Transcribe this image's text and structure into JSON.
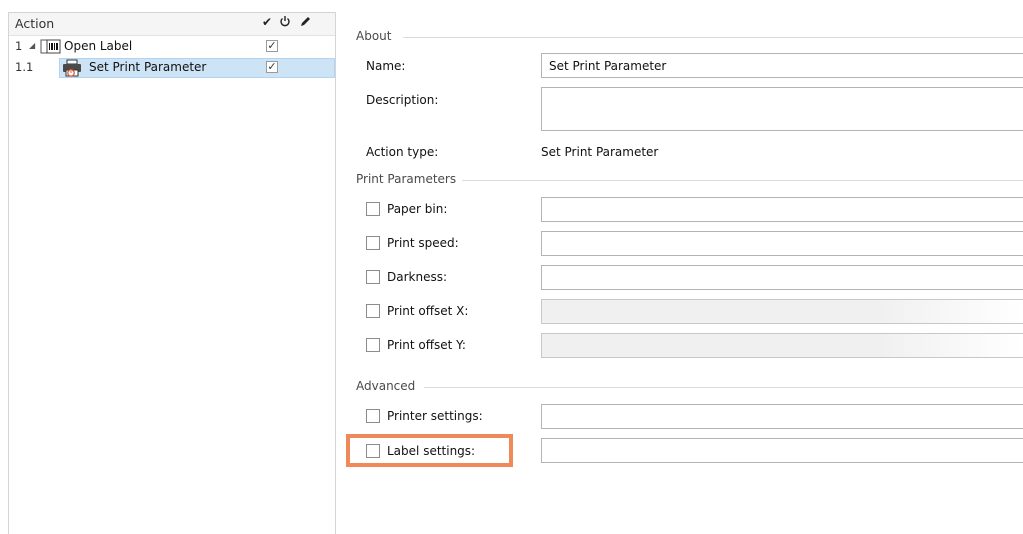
{
  "tree": {
    "header": "Action",
    "header_icons": [
      "checkmark-icon",
      "power-icon",
      "pencil-icon"
    ],
    "rows": [
      {
        "num": "1",
        "expander": "◢",
        "icon": "label-document-icon",
        "label": "Open Label",
        "checked": true,
        "selected": false
      },
      {
        "num": "1.1",
        "icon": "printer-icon",
        "label": "Set Print Parameter",
        "checked": true,
        "selected": true
      }
    ]
  },
  "about": {
    "title": "About",
    "name_label": "Name:",
    "name_value": "Set Print Parameter",
    "description_label": "Description:",
    "description_value": "",
    "action_type_label": "Action type:",
    "action_type_value": "Set Print Parameter"
  },
  "print_parameters": {
    "title": "Print Parameters",
    "items": [
      {
        "label": "Paper bin:",
        "checked": false,
        "value": "",
        "disabled": false
      },
      {
        "label": "Print speed:",
        "checked": false,
        "value": "",
        "disabled": false
      },
      {
        "label": "Darkness:",
        "checked": false,
        "value": "",
        "disabled": false
      },
      {
        "label": "Print offset X:",
        "checked": false,
        "value": "",
        "disabled": true
      },
      {
        "label": "Print offset Y:",
        "checked": false,
        "value": "",
        "disabled": true
      }
    ]
  },
  "advanced": {
    "title": "Advanced",
    "items": [
      {
        "label": "Printer settings:",
        "checked": false,
        "value": ""
      },
      {
        "label": "Label settings:",
        "checked": false,
        "value": ""
      }
    ]
  },
  "colors": {
    "selection": "#cde4f7",
    "highlight": "#f0895a"
  }
}
